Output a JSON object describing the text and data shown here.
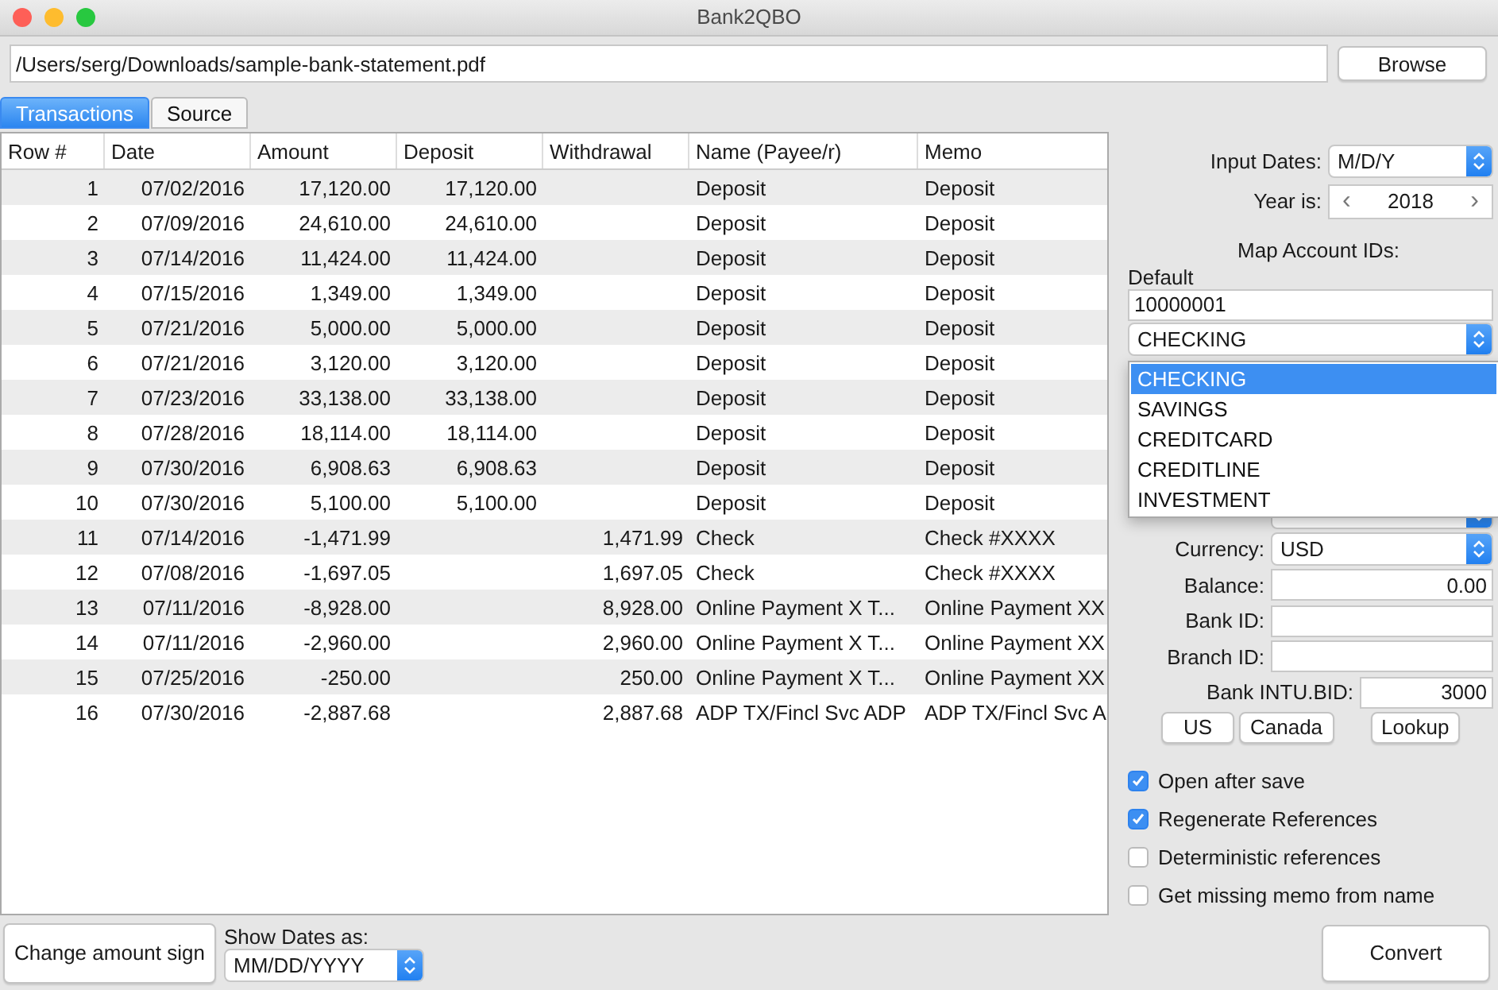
{
  "window": {
    "title": "Bank2QBO"
  },
  "file_path": {
    "value": "/Users/serg/Downloads/sample-bank-statement.pdf",
    "button": "Browse"
  },
  "tabs": [
    {
      "label": "Transactions",
      "selected": true
    },
    {
      "label": "Source",
      "selected": false
    }
  ],
  "table": {
    "columns": [
      "Row #",
      "Date",
      "Amount",
      "Deposit",
      "Withdrawal",
      "Name (Payee/r)",
      "Memo"
    ],
    "rows": [
      [
        "1",
        "07/02/2016",
        "17,120.00",
        "17,120.00",
        "",
        "Deposit",
        "Deposit"
      ],
      [
        "2",
        "07/09/2016",
        "24,610.00",
        "24,610.00",
        "",
        "Deposit",
        "Deposit"
      ],
      [
        "3",
        "07/14/2016",
        "11,424.00",
        "11,424.00",
        "",
        "Deposit",
        "Deposit"
      ],
      [
        "4",
        "07/15/2016",
        "1,349.00",
        "1,349.00",
        "",
        "Deposit",
        "Deposit"
      ],
      [
        "5",
        "07/21/2016",
        "5,000.00",
        "5,000.00",
        "",
        "Deposit",
        "Deposit"
      ],
      [
        "6",
        "07/21/2016",
        "3,120.00",
        "3,120.00",
        "",
        "Deposit",
        "Deposit"
      ],
      [
        "7",
        "07/23/2016",
        "33,138.00",
        "33,138.00",
        "",
        "Deposit",
        "Deposit"
      ],
      [
        "8",
        "07/28/2016",
        "18,114.00",
        "18,114.00",
        "",
        "Deposit",
        "Deposit"
      ],
      [
        "9",
        "07/30/2016",
        "6,908.63",
        "6,908.63",
        "",
        "Deposit",
        "Deposit"
      ],
      [
        "10",
        "07/30/2016",
        "5,100.00",
        "5,100.00",
        "",
        "Deposit",
        "Deposit"
      ],
      [
        "11",
        "07/14/2016",
        "-1,471.99",
        "",
        "1,471.99",
        "Check",
        "Check #XXXX"
      ],
      [
        "12",
        "07/08/2016",
        "-1,697.05",
        "",
        "1,697.05",
        "Check",
        "Check #XXXX"
      ],
      [
        "13",
        "07/11/2016",
        "-8,928.00",
        "",
        "8,928.00",
        "Online Payment X T...",
        "Online Payment XX"
      ],
      [
        "14",
        "07/11/2016",
        "-2,960.00",
        "",
        "2,960.00",
        "Online Payment X T...",
        "Online Payment XX"
      ],
      [
        "15",
        "07/25/2016",
        "-250.00",
        "",
        "250.00",
        "Online Payment X T...",
        "Online Payment XX"
      ],
      [
        "16",
        "07/30/2016",
        "-2,887.68",
        "",
        "2,887.68",
        "ADP TX/Fincl Svc ADP",
        "ADP TX/Fincl Svc A"
      ]
    ]
  },
  "settings": {
    "input_dates": {
      "label": "Input Dates:",
      "value": "M/D/Y"
    },
    "year": {
      "label": "Year is:",
      "value": "2018",
      "prev": "‹",
      "next": "›"
    },
    "map_heading": "Map Account IDs:",
    "account": {
      "label": "Default",
      "id": "10000001",
      "type": "CHECKING",
      "options": [
        {
          "label": "CHECKING",
          "selected": true
        },
        {
          "label": "SAVINGS",
          "selected": false
        },
        {
          "label": "CREDITCARD",
          "selected": false
        },
        {
          "label": "CREDITLINE",
          "selected": false
        },
        {
          "label": "INVESTMENT",
          "selected": false
        }
      ]
    },
    "currency": {
      "label": "Currency:",
      "value": "USD"
    },
    "fields": [
      {
        "label": "Balance:",
        "value": "0.00"
      },
      {
        "label": "Bank ID:"
      },
      {
        "label": "Branch ID:"
      }
    ],
    "intu_bid": {
      "label": "Bank INTU.BID:",
      "value": "3000"
    },
    "buttons": [
      "US",
      "Canada",
      "Lookup"
    ],
    "options": [
      {
        "label": "Open after save",
        "checked": true
      },
      {
        "label": "Regenerate References",
        "checked": true
      },
      {
        "label": "Deterministic references",
        "checked": false
      },
      {
        "label": "Get missing memo from name",
        "checked": false
      }
    ]
  },
  "bottom": {
    "sign_button": "Change amount sign",
    "show_dates_label": "Show Dates as:",
    "show_dates_value": "MM/DD/YYYY",
    "convert": "Convert"
  }
}
